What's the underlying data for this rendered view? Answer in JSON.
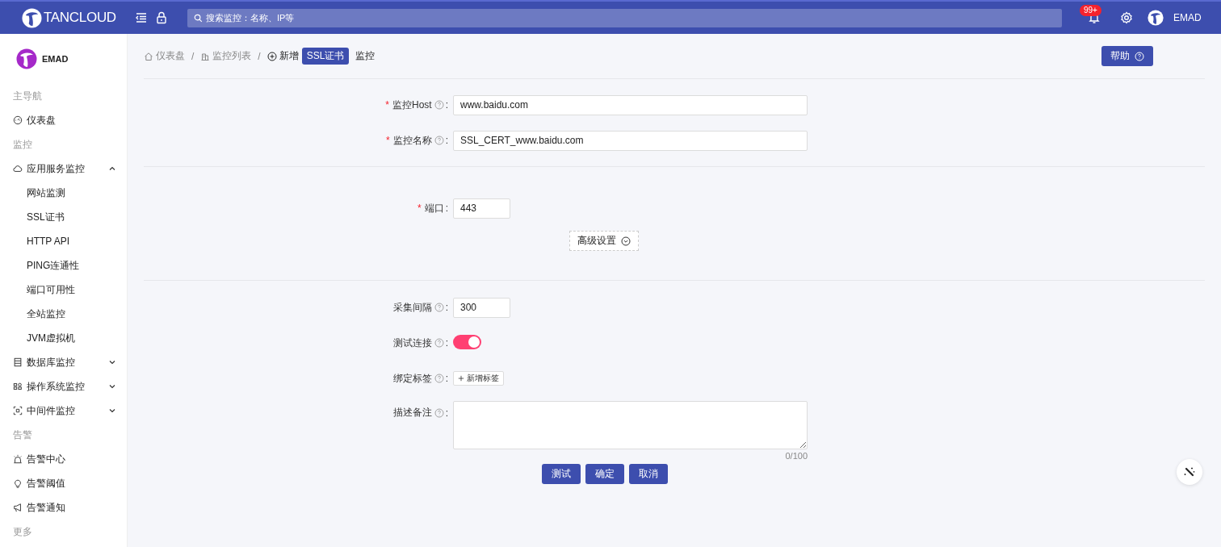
{
  "header": {
    "logo_text": "TANCLOUD",
    "search": {
      "placeholder": "搜索监控：名称、IP等"
    },
    "notification_badge": "99+",
    "user": "EMAD"
  },
  "sidebar": {
    "user": "EMAD",
    "sections": [
      {
        "title": "主导航",
        "items": [
          {
            "label": "仪表盘",
            "selected": false
          }
        ]
      },
      {
        "title": "监控",
        "items": [
          {
            "label": "应用服务监控",
            "selected": false,
            "expanded": true,
            "children": [
              {
                "label": "网站监测",
                "selected": false
              },
              {
                "label": "SSL证书",
                "selected": false
              },
              {
                "label": "HTTP API",
                "selected": false
              },
              {
                "label": "PING连通性",
                "selected": false
              },
              {
                "label": "端口可用性",
                "selected": false
              },
              {
                "label": "全站监控",
                "selected": false
              },
              {
                "label": "JVM虚拟机",
                "selected": false
              }
            ]
          },
          {
            "label": "数据库监控",
            "selected": false,
            "expanded": false
          },
          {
            "label": "操作系统监控",
            "selected": false,
            "expanded": false
          },
          {
            "label": "中间件监控",
            "selected": false,
            "expanded": false
          }
        ]
      },
      {
        "title": "告警",
        "items": [
          {
            "label": "告警中心",
            "selected": false
          },
          {
            "label": "告警阈值",
            "selected": false
          },
          {
            "label": "告警通知",
            "selected": false
          }
        ]
      },
      {
        "title": "更多"
      }
    ]
  },
  "breadcrumb": {
    "separator": "/",
    "items": [
      "仪表盘",
      "监控列表"
    ],
    "current": {
      "prefix": "新增",
      "tag": "SSL证书",
      "suffix": "监控"
    }
  },
  "help_button": "帮助",
  "form": {
    "required_mark": "*",
    "label_suffix": ":",
    "sections": [
      {
        "fields": [
          {
            "kind": "text",
            "label": "监控Host",
            "required": true,
            "help": true,
            "value": "www.baidu.com"
          },
          {
            "kind": "text",
            "label": "监控名称",
            "required": true,
            "help": true,
            "value": "SSL_CERT_www.baidu.com"
          }
        ]
      },
      {
        "fields": [
          {
            "kind": "number",
            "label": "端口",
            "required": true,
            "help": false,
            "value": "443"
          }
        ],
        "advanced_button": "高级设置"
      },
      {
        "fields": [
          {
            "kind": "number",
            "label": "采集间隔",
            "required": false,
            "help": true,
            "value": "300"
          },
          {
            "kind": "toggle",
            "label": "测试连接",
            "required": false,
            "help": true,
            "on": true
          },
          {
            "kind": "tags",
            "label": "绑定标签",
            "required": false,
            "help": true,
            "add_button": "新增标签"
          },
          {
            "kind": "textarea",
            "label": "描述备注",
            "required": false,
            "help": true,
            "counter": "0/100"
          }
        ]
      }
    ],
    "buttons": [
      "测试",
      "确定",
      "取消"
    ]
  }
}
